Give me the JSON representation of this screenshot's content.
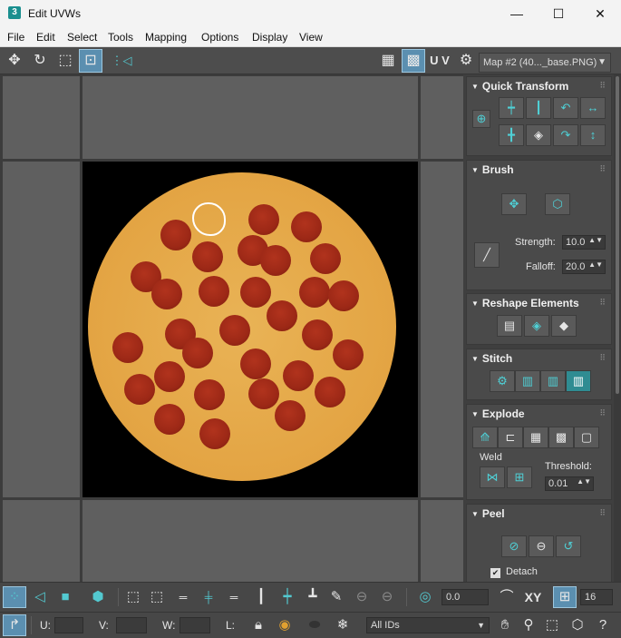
{
  "window": {
    "app_icon": "3",
    "title": "Edit UVWs",
    "minimize_icon": "—",
    "maximize_icon": "☐",
    "close_icon": "✕"
  },
  "menu": {
    "items": [
      "File",
      "Edit",
      "Select",
      "Tools",
      "Mapping",
      "Options",
      "Display",
      "View"
    ]
  },
  "toolbar": {
    "move_icon": "✥",
    "rotate_icon": "↻",
    "scale_icon": "⬚",
    "freeform_icon": "⊡",
    "mirror_icon": "⋮◁",
    "checker_icon": "▦",
    "checker2_icon": "▩",
    "uv_label": "U V",
    "map_settings_icon": "⚙",
    "map_dropdown": "Map #2 (40..._base.PNG)",
    "dropdown_arrow": "▼"
  },
  "sidebar": {
    "grip": "⠿",
    "collapse_icon": "▼",
    "quick_transform": {
      "title": "Quick Transform"
    },
    "brush": {
      "title": "Brush",
      "strength_label": "Strength:",
      "strength_value": "10.0",
      "falloff_label": "Falloff:",
      "falloff_value": "20.0"
    },
    "reshape": {
      "title": "Reshape Elements"
    },
    "stitch": {
      "title": "Stitch"
    },
    "explode": {
      "title": "Explode",
      "weld_label": "Weld",
      "threshold_label": "Threshold:",
      "threshold_value": "0.01"
    },
    "peel": {
      "title": "Peel",
      "detach_label": "Detach",
      "detach_checked": "✔"
    },
    "spinner_glyph": "▲▼"
  },
  "bottom": {
    "angle_value": "0.0",
    "xy_label": "XY",
    "grid_value": "16",
    "u_label": "U:",
    "v_label": "V:",
    "w_label": "W:",
    "l_label": "L:",
    "ids_dropdown": "All IDs",
    "dropdown_arrow": "▼"
  },
  "colors": {
    "accent": "#53c9d0",
    "active_button": "#5b8fb0",
    "viewport_bg": "#5f5f5f",
    "panel_bg": "#4a4a4a"
  }
}
